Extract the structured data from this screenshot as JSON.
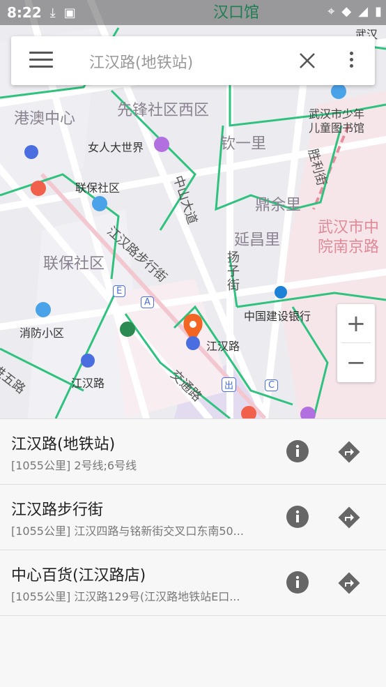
{
  "status_bar": {
    "time": "8:22"
  },
  "search": {
    "query": "江汉路(地铁站)"
  },
  "map": {
    "labels": {
      "gang_ao": "港澳中心",
      "xianfeng": "先锋社区西区",
      "library_1": "武汉市少年",
      "library_2": "儿童图书馆",
      "nvren": "女人大世界",
      "qinyi": "钦一里",
      "shengli": "胜利街",
      "lianbao_comm": "联保社区",
      "zhongshan": "中山大道",
      "dingyu": "鼎余里",
      "wuhan_zhong_1": "武汉市中",
      "wuhan_zhong_2": "院南京路",
      "jianghan_walk": "江汉路步行街",
      "yanchang": "延昌里",
      "lianbao_area": "联保社区",
      "yangzi": "扬子街",
      "ccb": "中国建设银行",
      "xiaofang": "消防小区",
      "jianghan_metro": "江汉路",
      "jiaotong": "交通路",
      "jianghan_metro2": "江汉路",
      "jinjin": "进五路",
      "top_a": "武汉",
      "top_b": "汉口馆",
      "poi_a": "A",
      "poi_e": "E",
      "poi_c": "C",
      "poi_out": "出"
    }
  },
  "zoom": {
    "in": "+",
    "out": "−"
  },
  "results": [
    {
      "title": "江汉路(地铁站)",
      "distance": "[1055公里]",
      "detail": "2号线;6号线"
    },
    {
      "title": "江汉路步行街",
      "distance": "[1055公里]",
      "detail": "江汉四路与铭新街交叉口东南50..."
    },
    {
      "title": "中心百货(江汉路店)",
      "distance": "[1055公里]",
      "detail": "江汉路129号(江汉路地铁站E口..."
    }
  ]
}
